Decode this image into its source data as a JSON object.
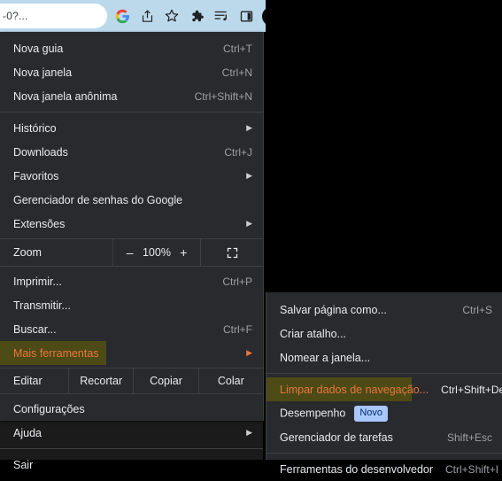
{
  "toolbar": {
    "omnibox_text": "-0?...",
    "icons": [
      {
        "name": "google-icon",
        "title": "Google"
      },
      {
        "name": "share-icon",
        "title": "Compartilhar"
      },
      {
        "name": "bookmark-star-icon",
        "title": "Favoritar"
      },
      {
        "name": "extensions-puzzle-icon",
        "title": "Extensões"
      },
      {
        "name": "media-playlist-icon",
        "title": "Controles de mídia"
      },
      {
        "name": "side-panel-icon",
        "title": "Painel lateral"
      },
      {
        "name": "avatar-icon",
        "title": "Perfil"
      }
    ],
    "menu_button": "three-dot-menu-icon",
    "menu_button_color": "#c8571d"
  },
  "main_menu": {
    "groups": [
      {
        "items": [
          {
            "label": "Nova guia",
            "accel": "Ctrl+T",
            "arrow": false
          },
          {
            "label": "Nova janela",
            "accel": "Ctrl+N",
            "arrow": false
          },
          {
            "label": "Nova janela anônima",
            "accel": "Ctrl+Shift+N",
            "arrow": false
          }
        ]
      },
      {
        "items": [
          {
            "label": "Histórico",
            "accel": "",
            "arrow": true
          },
          {
            "label": "Downloads",
            "accel": "Ctrl+J",
            "arrow": false
          },
          {
            "label": "Favoritos",
            "accel": "",
            "arrow": true
          },
          {
            "label": "Gerenciador de senhas do Google",
            "accel": "",
            "arrow": false
          },
          {
            "label": "Extensões",
            "accel": "",
            "arrow": true
          }
        ]
      }
    ],
    "zoom_row": {
      "label": "Zoom",
      "minus": "–",
      "value": "100%",
      "plus": "+",
      "fullscreen_icon": "fullscreen-icon"
    },
    "group3": {
      "items": [
        {
          "label": "Imprimir...",
          "accel": "Ctrl+P",
          "arrow": false
        },
        {
          "label": "Transmitir...",
          "accel": "",
          "arrow": false
        },
        {
          "label": "Buscar...",
          "accel": "Ctrl+F",
          "arrow": false
        },
        {
          "label": "Mais ferramentas",
          "accel": "",
          "arrow": true,
          "highlighted": true
        }
      ]
    },
    "edit_row": {
      "label": "Editar",
      "cut": "Recortar",
      "copy": "Copiar",
      "paste": "Colar"
    },
    "group4": {
      "items": [
        {
          "label": "Configurações",
          "accel": "",
          "arrow": false
        },
        {
          "label": "Ajuda",
          "accel": "",
          "arrow": true
        }
      ]
    },
    "group5": {
      "items": [
        {
          "label": "Sair",
          "accel": "",
          "arrow": false
        }
      ]
    }
  },
  "submenu": {
    "group1": {
      "items": [
        {
          "label": "Salvar página como...",
          "accel": "Ctrl+S",
          "arrow": false
        },
        {
          "label": "Criar atalho...",
          "accel": "",
          "arrow": false
        },
        {
          "label": "Nomear a janela...",
          "accel": "",
          "arrow": false
        }
      ]
    },
    "group2": {
      "items": [
        {
          "label": "Limpar dados de navegação...",
          "accel": "Ctrl+Shift+Del",
          "arrow": false,
          "highlighted": true
        },
        {
          "label": "Desempenho",
          "accel": "",
          "badge": "Novo",
          "arrow": false
        },
        {
          "label": "Gerenciador de tarefas",
          "accel": "Shift+Esc",
          "arrow": false
        }
      ]
    },
    "group3": {
      "items": [
        {
          "label": "Ferramentas do desenvolvedor",
          "accel": "Ctrl+Shift+I",
          "arrow": false
        }
      ]
    }
  },
  "colors": {
    "menu_bg": "#292a2d",
    "menu_text": "#e8eaed",
    "accel_text": "#9aa0a6",
    "separator": "#3c4043",
    "highlight_bg": "#4d4a16",
    "highlight_text": "#e8763b",
    "badge_bg": "#a8c7fa",
    "toolbar_bg": "#bcd9ec",
    "menu_button_bg": "#c8571d"
  }
}
